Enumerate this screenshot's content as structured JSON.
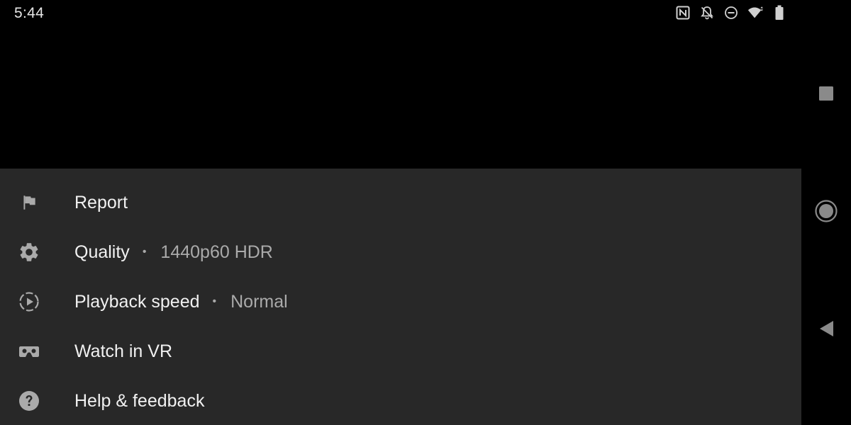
{
  "status_bar": {
    "time": "5:44",
    "icons": [
      "nfc-icon",
      "notifications-off-icon",
      "do-not-disturb-icon",
      "wifi-icon",
      "battery-icon"
    ]
  },
  "menu": {
    "items": [
      {
        "icon": "flag-icon",
        "label": "Report"
      },
      {
        "icon": "gear-icon",
        "label": "Quality",
        "separator": "•",
        "value": "1440p60 HDR"
      },
      {
        "icon": "playback-speed-icon",
        "label": "Playback speed",
        "separator": "•",
        "value": "Normal"
      },
      {
        "icon": "vr-headset-icon",
        "label": "Watch in VR"
      },
      {
        "icon": "help-icon",
        "label": "Help & feedback"
      }
    ]
  },
  "nav_bar": {
    "buttons": [
      "recents-square-icon",
      "home-circle-icon",
      "back-triangle-icon"
    ]
  },
  "colors": {
    "sheet_background": "#282828",
    "primary_text": "#f1f1f1",
    "secondary_text": "#aaaaaa",
    "icon_color": "#aaaaaa"
  }
}
